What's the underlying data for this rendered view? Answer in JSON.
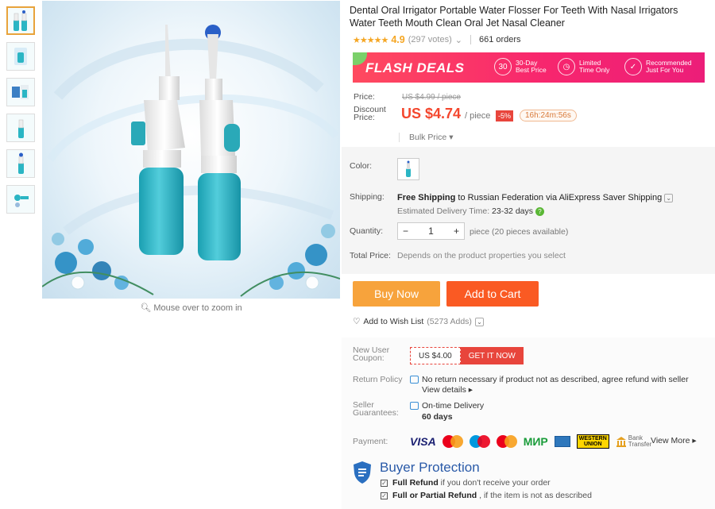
{
  "gallery": {
    "zoom_hint": "Mouse over to zoom in",
    "thumbnails": [
      "thumb-1",
      "thumb-2",
      "thumb-3",
      "thumb-4",
      "thumb-5",
      "thumb-6"
    ]
  },
  "product": {
    "title": "Dental Oral Irrigator Portable Water Flosser For Teeth With Nasal Irrigators Water Teeth Mouth Clean Oral Jet Nasal Cleaner",
    "rating": "4.9",
    "votes": "(297 votes)",
    "orders": "661 orders"
  },
  "flash_deals": {
    "title": "FLASH DEALS",
    "features": [
      {
        "line1": "30-Day",
        "line2": "Best Price",
        "icon": "30"
      },
      {
        "line1": "Limited",
        "line2": "Time Only",
        "icon": "clock"
      },
      {
        "line1": "Recommended",
        "line2": "Just For You",
        "icon": "thumb"
      }
    ]
  },
  "price": {
    "price_label": "Price:",
    "old_price": "US $4.99 / piece",
    "discount_label_1": "Discount",
    "discount_label_2": "Price:",
    "current_price": "US $4.74",
    "per": "/ piece",
    "discount": "-5%",
    "timer": "16h:24m:56s",
    "bulk": "Bulk Price"
  },
  "options": {
    "color_label": "Color:",
    "shipping_label": "Shipping:",
    "shipping_bold": "Free Shipping",
    "shipping_to": " to Russian Federation via AliExpress Saver Shipping ",
    "eta_label": "Estimated Delivery Time: ",
    "eta_value": "23-32 days",
    "quantity_label": "Quantity:",
    "quantity": "1",
    "quantity_note": "piece (20 pieces available)",
    "total_label": "Total Price:",
    "total_note": "Depends on the product properties you select"
  },
  "actions": {
    "buy_now": "Buy Now",
    "add_to_cart": "Add to Cart",
    "wish": "Add to Wish List",
    "wish_count": "(5273 Adds)"
  },
  "coupon": {
    "label_1": "New User",
    "label_2": "Coupon:",
    "amount": "US $4.00",
    "cta": "GET IT NOW"
  },
  "return_policy": {
    "label": "Return Policy",
    "text": "No return necessary if product not as described, agree refund with seller",
    "link": "View details"
  },
  "seller_guarantees": {
    "label_1": "Seller",
    "label_2": "Guarantees:",
    "title": "On-time Delivery",
    "value": "60 days"
  },
  "payment": {
    "label": "Payment:",
    "visa": "VISA",
    "mir": "МИР",
    "wu_1": "WESTERN",
    "wu_2": "UNION",
    "bank_1": "Bank",
    "bank_2": "Transfer",
    "view_more": "View More"
  },
  "buyer_protection": {
    "title": "Buyer Protection",
    "item1_bold": "Full Refund",
    "item1_rest": " if you don't receive your order",
    "item2_bold": "Full or Partial Refund",
    "item2_rest": " , if the item is not as described"
  },
  "colors": {
    "accent_orange": "#f7a33c",
    "accent_red": "#fa5a23",
    "price_red": "#f4472e",
    "protection_blue": "#2a5aa8"
  }
}
